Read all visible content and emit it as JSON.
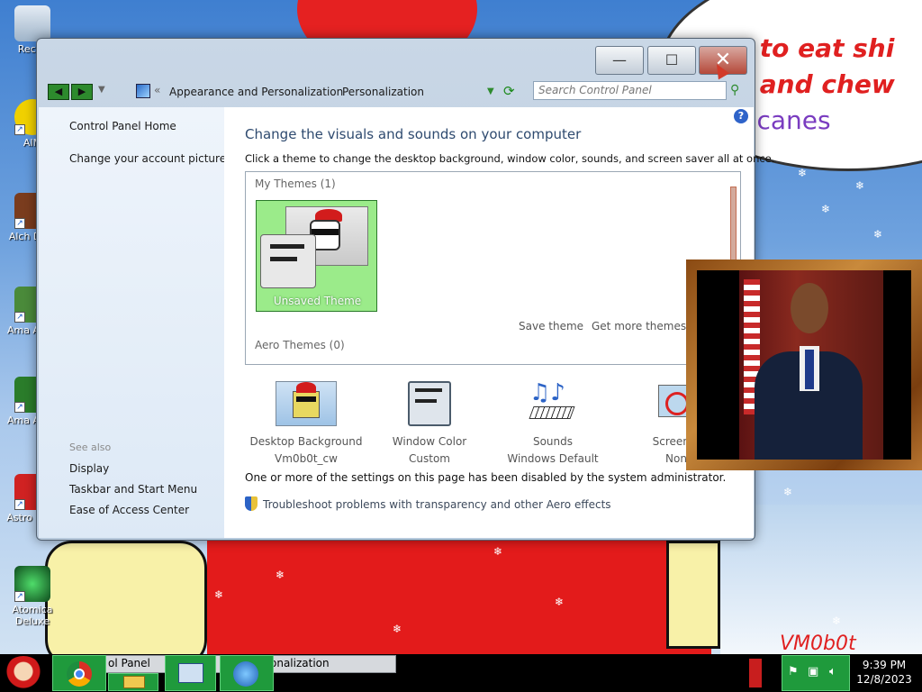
{
  "desktop": {
    "icons": [
      {
        "label": "Recyc",
        "color": "#c9d8e8"
      },
      {
        "label": "AIM",
        "color": "#f0d000"
      },
      {
        "label": "Alch Delu",
        "color": "#7a3c1e"
      },
      {
        "label": "Ama Adve",
        "color": "#4a8a3a"
      },
      {
        "label": "Ama Adve",
        "color": "#2a7c2a"
      },
      {
        "label": "Astro Delu",
        "color": "#d02222"
      },
      {
        "label": "Atomica Deluxe",
        "color": "#1b6b2b"
      }
    ],
    "bubble_lines": [
      "e to eat shi",
      "e and chew",
      "y canes"
    ],
    "watermark": "VM0b0t"
  },
  "window": {
    "title_buttons": {
      "minimize": "—",
      "maximize": "☐",
      "close": "✕"
    },
    "breadcrumb": [
      "Appearance and Personalization",
      "Personalization"
    ],
    "search_placeholder": "Search Control Panel",
    "sidebar": {
      "home_link": "Control Panel Home",
      "account_link": "Change your account picture",
      "see_also_heading": "See also",
      "see_also_links": [
        "Display",
        "Taskbar and Start Menu",
        "Ease of Access Center"
      ]
    },
    "main": {
      "title": "Change the visuals and sounds on your computer",
      "subtitle": "Click a theme to change the desktop background, window color, sounds, and screen saver all at once.",
      "my_themes_label": "My Themes (1)",
      "selected_theme": "Unsaved Theme",
      "save_theme": "Save theme",
      "get_more_themes": "Get more themes o",
      "aero_themes_label": "Aero Themes (0)",
      "options": [
        {
          "label": "Desktop Background",
          "value": "Vm0b0t_cw"
        },
        {
          "label": "Window Color",
          "value": "Custom"
        },
        {
          "label": "Sounds",
          "value": "Windows Default"
        },
        {
          "label": "Screen S",
          "value": "Non"
        }
      ],
      "disabled_message": "One or more of the settings on this page has been disabled by the system administrator.",
      "troubleshoot_link": "Troubleshoot problems with transparency and other Aero effects"
    }
  },
  "taskbar": {
    "active_window_1": "ol Panel",
    "active_window_2": "onalization",
    "clock_time": "9:39 PM",
    "clock_date": "12/8/2023"
  }
}
